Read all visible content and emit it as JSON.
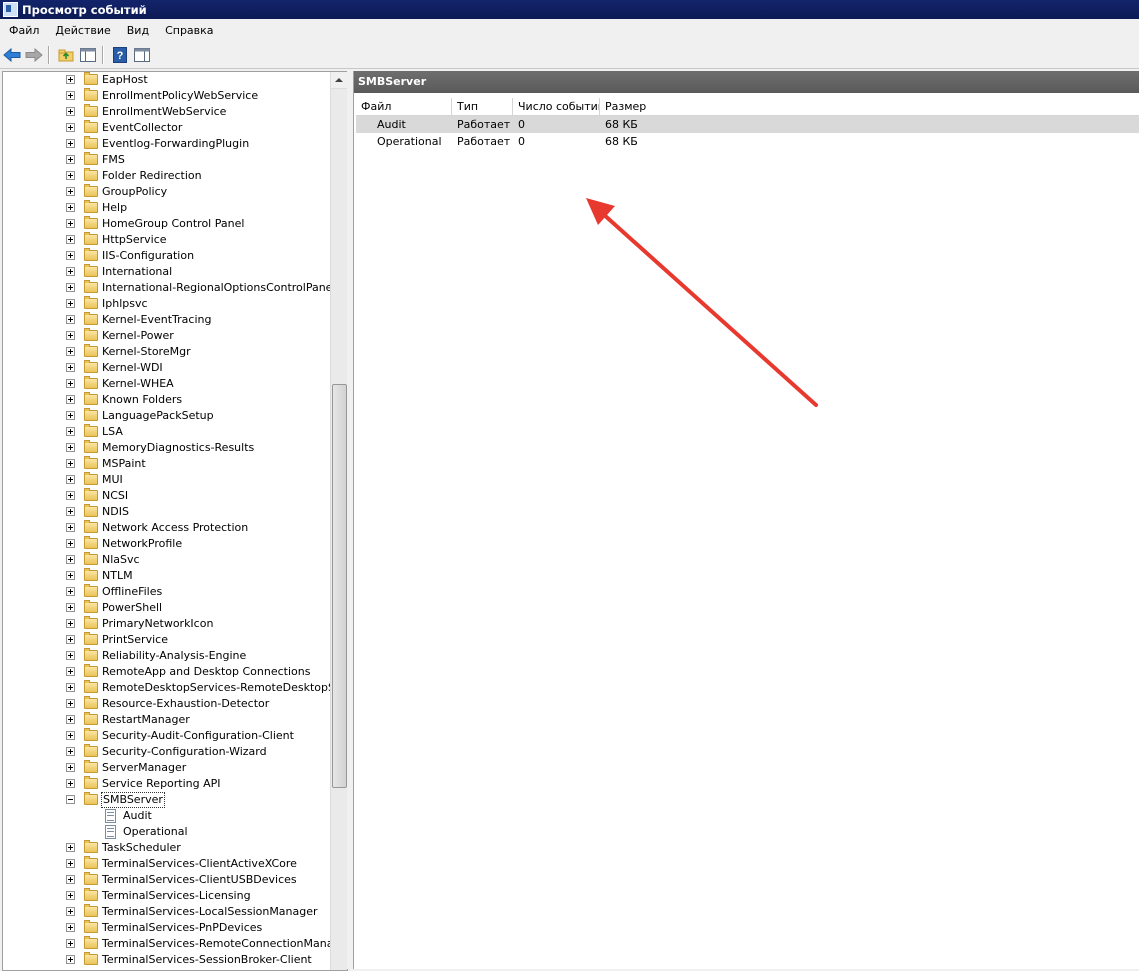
{
  "window": {
    "title": "Просмотр событий"
  },
  "menu": [
    "Файл",
    "Действие",
    "Вид",
    "Справка"
  ],
  "toolbar": {
    "icons": [
      "back-arrow-icon",
      "forward-arrow-icon",
      "up-folder-icon",
      "show-hide-console-tree-icon",
      "help-icon",
      "show-hide-action-pane-icon"
    ]
  },
  "tree": {
    "items": [
      {
        "label": "EapHost",
        "type": "folder",
        "expander": "plus"
      },
      {
        "label": "EnrollmentPolicyWebService",
        "type": "folder",
        "expander": "plus"
      },
      {
        "label": "EnrollmentWebService",
        "type": "folder",
        "expander": "plus"
      },
      {
        "label": "EventCollector",
        "type": "folder",
        "expander": "plus"
      },
      {
        "label": "Eventlog-ForwardingPlugin",
        "type": "folder",
        "expander": "plus"
      },
      {
        "label": "FMS",
        "type": "folder",
        "expander": "plus"
      },
      {
        "label": "Folder Redirection",
        "type": "folder",
        "expander": "plus"
      },
      {
        "label": "GroupPolicy",
        "type": "folder",
        "expander": "plus"
      },
      {
        "label": "Help",
        "type": "folder",
        "expander": "plus"
      },
      {
        "label": "HomeGroup Control Panel",
        "type": "folder",
        "expander": "plus"
      },
      {
        "label": "HttpService",
        "type": "folder",
        "expander": "plus"
      },
      {
        "label": "IIS-Configuration",
        "type": "folder",
        "expander": "plus"
      },
      {
        "label": "International",
        "type": "folder",
        "expander": "plus"
      },
      {
        "label": "International-RegionalOptionsControlPanel",
        "type": "folder",
        "expander": "plus"
      },
      {
        "label": "Iphlpsvc",
        "type": "folder",
        "expander": "plus"
      },
      {
        "label": "Kernel-EventTracing",
        "type": "folder",
        "expander": "plus"
      },
      {
        "label": "Kernel-Power",
        "type": "folder",
        "expander": "plus"
      },
      {
        "label": "Kernel-StoreMgr",
        "type": "folder",
        "expander": "plus"
      },
      {
        "label": "Kernel-WDI",
        "type": "folder",
        "expander": "plus"
      },
      {
        "label": "Kernel-WHEA",
        "type": "folder",
        "expander": "plus"
      },
      {
        "label": "Known Folders",
        "type": "folder",
        "expander": "plus"
      },
      {
        "label": "LanguagePackSetup",
        "type": "folder",
        "expander": "plus"
      },
      {
        "label": "LSA",
        "type": "folder",
        "expander": "plus"
      },
      {
        "label": "MemoryDiagnostics-Results",
        "type": "folder",
        "expander": "plus"
      },
      {
        "label": "MSPaint",
        "type": "folder",
        "expander": "plus"
      },
      {
        "label": "MUI",
        "type": "folder",
        "expander": "plus"
      },
      {
        "label": "NCSI",
        "type": "folder",
        "expander": "plus"
      },
      {
        "label": "NDIS",
        "type": "folder",
        "expander": "plus"
      },
      {
        "label": "Network Access Protection",
        "type": "folder",
        "expander": "plus"
      },
      {
        "label": "NetworkProfile",
        "type": "folder",
        "expander": "plus"
      },
      {
        "label": "NlaSvc",
        "type": "folder",
        "expander": "plus"
      },
      {
        "label": "NTLM",
        "type": "folder",
        "expander": "plus"
      },
      {
        "label": "OfflineFiles",
        "type": "folder",
        "expander": "plus"
      },
      {
        "label": "PowerShell",
        "type": "folder",
        "expander": "plus"
      },
      {
        "label": "PrimaryNetworkIcon",
        "type": "folder",
        "expander": "plus"
      },
      {
        "label": "PrintService",
        "type": "folder",
        "expander": "plus"
      },
      {
        "label": "Reliability-Analysis-Engine",
        "type": "folder",
        "expander": "plus"
      },
      {
        "label": "RemoteApp and Desktop Connections",
        "type": "folder",
        "expander": "plus"
      },
      {
        "label": "RemoteDesktopServices-RemoteDesktopSession",
        "type": "folder",
        "expander": "plus"
      },
      {
        "label": "Resource-Exhaustion-Detector",
        "type": "folder",
        "expander": "plus"
      },
      {
        "label": "RestartManager",
        "type": "folder",
        "expander": "plus"
      },
      {
        "label": "Security-Audit-Configuration-Client",
        "type": "folder",
        "expander": "plus"
      },
      {
        "label": "Security-Configuration-Wizard",
        "type": "folder",
        "expander": "plus"
      },
      {
        "label": "ServerManager",
        "type": "folder",
        "expander": "plus"
      },
      {
        "label": "Service Reporting API",
        "type": "folder",
        "expander": "plus"
      },
      {
        "label": "SMBServer",
        "type": "folder",
        "expander": "minus",
        "selected": true
      },
      {
        "label": "Audit",
        "type": "log",
        "child": true
      },
      {
        "label": "Operational",
        "type": "log",
        "child": true
      },
      {
        "label": "TaskScheduler",
        "type": "folder",
        "expander": "plus"
      },
      {
        "label": "TerminalServices-ClientActiveXCore",
        "type": "folder",
        "expander": "plus"
      },
      {
        "label": "TerminalServices-ClientUSBDevices",
        "type": "folder",
        "expander": "plus"
      },
      {
        "label": "TerminalServices-Licensing",
        "type": "folder",
        "expander": "plus"
      },
      {
        "label": "TerminalServices-LocalSessionManager",
        "type": "folder",
        "expander": "plus"
      },
      {
        "label": "TerminalServices-PnPDevices",
        "type": "folder",
        "expander": "plus"
      },
      {
        "label": "TerminalServices-RemoteConnectionManager",
        "type": "folder",
        "expander": "plus"
      },
      {
        "label": "TerminalServices-SessionBroker-Client",
        "type": "folder",
        "expander": "plus"
      }
    ]
  },
  "main": {
    "header_title": "SMBServer",
    "columns": [
      "Файл",
      "Тип",
      "Число событий",
      "Размер"
    ],
    "rows": [
      {
        "name": "Audit",
        "type": "Работает",
        "count": "0",
        "size": "68 КБ",
        "selected": true
      },
      {
        "name": "Operational",
        "type": "Работает",
        "count": "0",
        "size": "68 КБ"
      }
    ]
  },
  "colors": {
    "annotation_arrow": "#e8392f",
    "title_bar": "#13246b",
    "pane_header": "#5f5f5f"
  }
}
